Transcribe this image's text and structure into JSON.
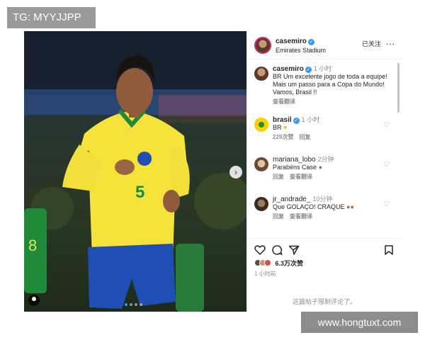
{
  "watermarks": {
    "top": "TG: MYYJJPP",
    "bottom": "www.hongtuxt.com"
  },
  "photo": {
    "jersey_number": "5",
    "carousel": {
      "count": 4,
      "active": 1
    }
  },
  "post_header": {
    "username": "casemiro",
    "location": "Emirates Stadium",
    "follow_status": "已关注",
    "more": "..."
  },
  "comments": [
    {
      "username": "casemiro",
      "time": "1 小时",
      "text": "BR Um excelente jogo de toda a equipe! Mais um passo para a Copa do Mundo! Vamos, Brasil !!",
      "meta": [
        "查看翻译"
      ],
      "verified": true,
      "caption": true
    },
    {
      "username": "brasil",
      "time": "1 小时",
      "text": "BR",
      "emoji": "♥",
      "meta": [
        "229次赞",
        "回复"
      ],
      "verified": true
    },
    {
      "username": "mariana_lobo",
      "time": "2分钟",
      "text": "Parabéns Case",
      "emoji": "●",
      "meta": [
        "回复",
        "查看翻译"
      ],
      "verified": false
    },
    {
      "username": "jr_andrade_",
      "time": "10分钟",
      "text": "Que GOLAÇO! CRAQUE",
      "emoji": "●●",
      "meta": [
        "回复",
        "查看翻译"
      ],
      "verified": false
    }
  ],
  "actions": {
    "likes": "6.3万次赞",
    "post_time": "1 小时前",
    "comments_limited": "这篇帖子限制评论了。"
  },
  "icons": {
    "like": "heart-icon",
    "comment": "comment-icon",
    "share": "share-icon",
    "save": "bookmark-icon"
  },
  "colors": {
    "verified": "#3897f0",
    "jersey": "#f5e23a",
    "shorts": "#1f4fb3"
  }
}
